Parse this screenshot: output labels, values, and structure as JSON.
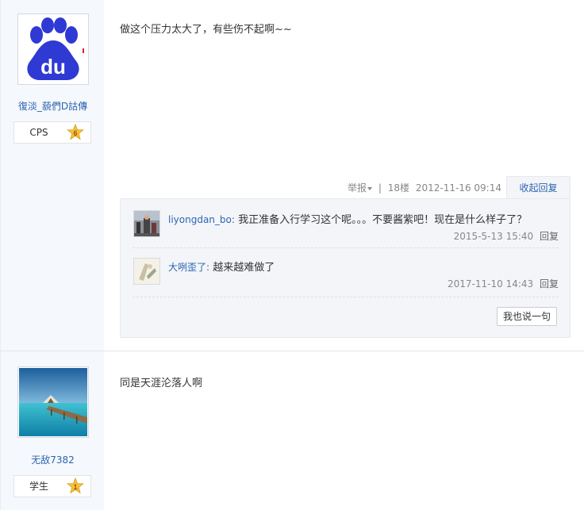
{
  "posts": [
    {
      "author": {
        "name": "復淡_藐們D詁傳",
        "level_name": "CPS",
        "level_num": "6",
        "avatar": "baidu-paw-logo"
      },
      "content": "做这个压力太大了，有些伤不起啊~~",
      "meta": {
        "report": "举报",
        "separator": "|",
        "floor": "18楼",
        "time": "2012-11-16 09:14",
        "collapse": "收起回复"
      },
      "replies": [
        {
          "user": "liyongdan_bo:",
          "text": "我正准备入行学习这个呢。。。不要酱紫吧！现在是什么样子了？",
          "time": "2015-5-13 15:40",
          "reply": "回复"
        },
        {
          "user": "大咧歪了:",
          "text": "越来越难做了",
          "time": "2017-11-10 14:43",
          "reply": "回复"
        }
      ],
      "say_button": "我也说一句"
    },
    {
      "author": {
        "name": "无敌7382",
        "level_name": "学生",
        "level_num": "1",
        "avatar": "sea-pier-photo"
      },
      "content": "同是天涯沦落人啊"
    }
  ]
}
